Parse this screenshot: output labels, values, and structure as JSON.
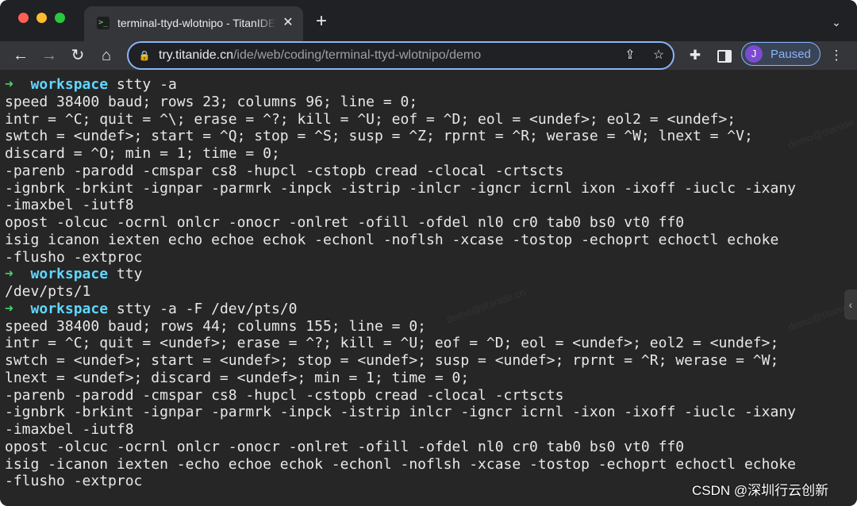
{
  "browser": {
    "tab": {
      "title": "terminal-ttyd-wlotnipo - TitanIDE",
      "favicon_text": ">_",
      "close_icon": "✕"
    },
    "new_tab_icon": "+",
    "tab_menu_icon": "⌄",
    "toolbar": {
      "back_icon": "←",
      "forward_icon": "→",
      "reload_icon": "↻",
      "home_icon": "⌂",
      "lock_icon": "🔒",
      "url_host": "try.titanide.cn",
      "url_path": "/ide/web/coding/terminal-ttyd-wlotnipo/demo",
      "share_icon": "⇪",
      "star_icon": "☆",
      "extensions_icon": "✚",
      "profile_initial": "J",
      "profile_label": "Paused",
      "menu_icon": "⋮"
    },
    "accent_color": "#8ab4f8"
  },
  "terminal": {
    "prompt_arrow": "➜",
    "prompt_cwd": "workspace",
    "lines": [
      {
        "type": "prompt",
        "cmd": "stty -a"
      },
      {
        "type": "out",
        "text": "speed 38400 baud; rows 23; columns 96; line = 0;"
      },
      {
        "type": "out",
        "text": "intr = ^C; quit = ^\\; erase = ^?; kill = ^U; eof = ^D; eol = <undef>; eol2 = <undef>;"
      },
      {
        "type": "out",
        "text": "swtch = <undef>; start = ^Q; stop = ^S; susp = ^Z; rprnt = ^R; werase = ^W; lnext = ^V;"
      },
      {
        "type": "out",
        "text": "discard = ^O; min = 1; time = 0;"
      },
      {
        "type": "out",
        "text": "-parenb -parodd -cmspar cs8 -hupcl -cstopb cread -clocal -crtscts"
      },
      {
        "type": "out",
        "text": "-ignbrk -brkint -ignpar -parmrk -inpck -istrip -inlcr -igncr icrnl ixon -ixoff -iuclc -ixany"
      },
      {
        "type": "out",
        "text": "-imaxbel -iutf8"
      },
      {
        "type": "out",
        "text": "opost -olcuc -ocrnl onlcr -onocr -onlret -ofill -ofdel nl0 cr0 tab0 bs0 vt0 ff0"
      },
      {
        "type": "out",
        "text": "isig icanon iexten echo echoe echok -echonl -noflsh -xcase -tostop -echoprt echoctl echoke"
      },
      {
        "type": "out",
        "text": "-flusho -extproc"
      },
      {
        "type": "prompt",
        "cmd": "tty"
      },
      {
        "type": "out",
        "text": "/dev/pts/1"
      },
      {
        "type": "prompt",
        "cmd": "stty -a -F /dev/pts/0"
      },
      {
        "type": "out",
        "text": "speed 38400 baud; rows 44; columns 155; line = 0;"
      },
      {
        "type": "out",
        "text": "intr = ^C; quit = <undef>; erase = ^?; kill = ^U; eof = ^D; eol = <undef>; eol2 = <undef>;"
      },
      {
        "type": "out",
        "text": "swtch = <undef>; start = <undef>; stop = <undef>; susp = <undef>; rprnt = ^R; werase = ^W;"
      },
      {
        "type": "out",
        "text": "lnext = <undef>; discard = <undef>; min = 1; time = 0;"
      },
      {
        "type": "out",
        "text": "-parenb -parodd -cmspar cs8 -hupcl -cstopb cread -clocal -crtscts"
      },
      {
        "type": "out",
        "text": "-ignbrk -brkint -ignpar -parmrk -inpck -istrip inlcr -igncr icrnl -ixon -ixoff -iuclc -ixany"
      },
      {
        "type": "out",
        "text": "-imaxbel -iutf8"
      },
      {
        "type": "out",
        "text": "opost -olcuc -ocrnl onlcr -onocr -onlret -ofill -ofdel nl0 cr0 tab0 bs0 vt0 ff0"
      },
      {
        "type": "out",
        "text": "isig -icanon iexten -echo echoe echok -echonl -noflsh -xcase -tostop -echoprt echoctl echoke"
      },
      {
        "type": "out",
        "text": "-flusho -extproc"
      }
    ],
    "side_handle_icon": "‹"
  },
  "watermark_text": "demo@titanide.cn",
  "overlay_credit": "CSDN @深圳行云创新"
}
